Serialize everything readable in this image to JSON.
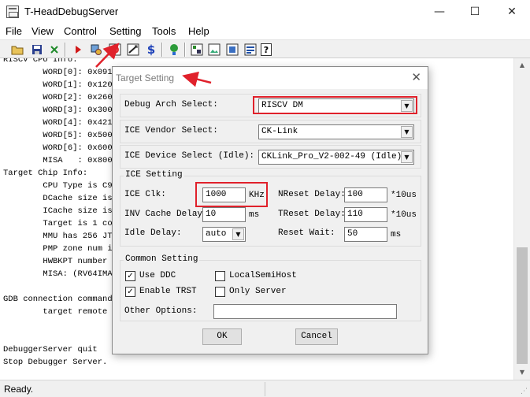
{
  "window": {
    "title": "T-HeadDebugServer",
    "minimize_glyph": "—",
    "maximize_glyph": "☐",
    "close_glyph": "✕"
  },
  "menu": [
    "File",
    "View",
    "Control",
    "Setting",
    "Tools",
    "Help"
  ],
  "toolbar": {
    "icons": [
      "open-folder-icon",
      "save-icon",
      "disconnect-icon",
      "run-icon",
      "settings-icon",
      "target-icon",
      "server-icon",
      "dollar-icon",
      "help-bulb-icon",
      "option-icon",
      "image-icon",
      "chip-icon",
      "register-icon",
      "question-icon"
    ],
    "dollar_glyph": "$",
    "question_glyph": "?"
  },
  "console": {
    "lines": [
      "RISCV CPU Info:",
      "        WORD[0]: 0x0910",
      "        WORD[1]: 0x1204",
      "        WORD[2]: 0x260c",
      "        WORD[3]: 0x3003",
      "        WORD[4]: 0x4218",
      "        WORD[5]: 0x5000",
      "        WORD[6]: 0x6000",
      "        MISA   : 0x8000",
      "Target Chip Info:",
      "        CPU Type is C90",
      "        DCache size is",
      "        ICache size is",
      "        Target is 1 cor",
      "        MMU has 256 JTL",
      "        PMP zone num is",
      "        HWBKPT number i",
      "        MISA: (RV64IMAF",
      "",
      "GDB connection command",
      "        target remote 1",
      "",
      "",
      "DebuggerServer quit",
      "Stop Debugger Server."
    ]
  },
  "status": {
    "text": "Ready."
  },
  "dialog": {
    "title": "Target Setting",
    "close_glyph": "✕",
    "debug_arch": {
      "label": "Debug Arch Select:",
      "value": "RISCV DM"
    },
    "ice_vendor": {
      "label": "ICE Vendor Select:",
      "value": "CK-Link"
    },
    "ice_device": {
      "label": "ICE Device Select (Idle):",
      "value": "CKLink_Pro_V2-002-49 (Idle)"
    },
    "ice_setting": {
      "legend": "ICE Setting",
      "ice_clk_label": "ICE Clk:",
      "ice_clk_value": "1000",
      "ice_clk_unit": "KHz",
      "inv_cache_delay_label": "INV Cache Delay:",
      "inv_cache_delay_value": "10",
      "inv_cache_delay_unit": "ms",
      "idle_delay_label": "Idle Delay:",
      "idle_delay_value": "auto",
      "nreset_delay_label": "NReset Delay:",
      "nreset_delay_value": "100",
      "nreset_delay_unit": "*10us",
      "treset_delay_label": "TReset Delay:",
      "treset_delay_value": "110",
      "treset_delay_unit": "*10us",
      "reset_wait_label": "Reset Wait:",
      "reset_wait_value": "50",
      "reset_wait_unit": "ms"
    },
    "common_setting": {
      "legend": "Common Setting",
      "use_ddc": {
        "label": "Use DDC",
        "checked": true
      },
      "local_semihost": {
        "label": "LocalSemiHost",
        "checked": false
      },
      "enable_trst": {
        "label": "Enable TRST",
        "checked": true
      },
      "only_server": {
        "label": "Only Server",
        "checked": false
      },
      "other_options_label": "Other Options:",
      "other_options_value": ""
    },
    "ok_label": "OK",
    "cancel_label": "Cancel",
    "check_glyph": "✓",
    "dropdown_glyph": "▼"
  },
  "annotations": {
    "color": "#e0212b"
  }
}
